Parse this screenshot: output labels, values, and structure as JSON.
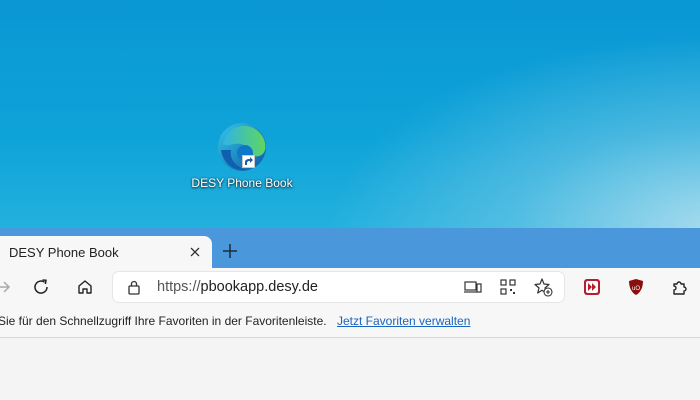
{
  "desktop": {
    "shortcut": {
      "label": "DESY Phone Book",
      "icon": "edge-icon"
    }
  },
  "browser": {
    "tab": {
      "title": "DESY Phone Book"
    },
    "toolbar": {
      "url_protocol": "https://",
      "url_host": "pbookapp.desy.de"
    },
    "favorites_bar": {
      "message": "Sie für den Schnellzugriff Ihre Favoriten in der Favoritenleiste.",
      "link": "Jetzt Favoriten verwalten"
    }
  },
  "colors": {
    "desktop": "#0a97d4",
    "tabbar": "#4a97dc",
    "toolbar": "#f7f7f7",
    "link": "#1a64c0",
    "extension_red": "#b3202b"
  }
}
